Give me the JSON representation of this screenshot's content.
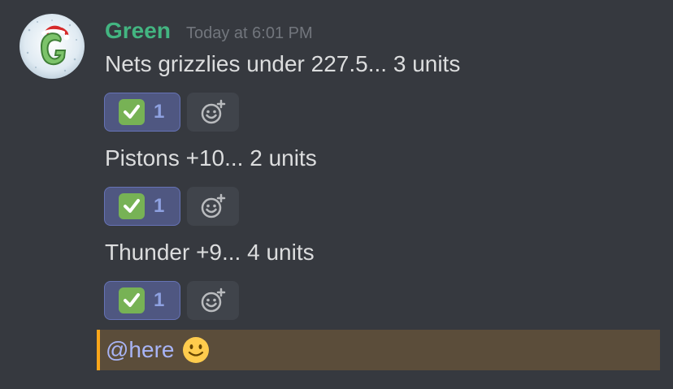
{
  "message": {
    "author": "Green",
    "timestamp": "Today at 6:01 PM",
    "avatar_icon": "g-logo-santa-hat-avatar",
    "lines": [
      {
        "text": "Nets grizzlies under 227.5... 3 units",
        "reaction_emoji": "check-mark-button-icon",
        "reaction_count": "1"
      },
      {
        "text": "Pistons +10... 2 units",
        "reaction_emoji": "check-mark-button-icon",
        "reaction_count": "1"
      },
      {
        "text": "Thunder +9... 4 units",
        "reaction_emoji": "check-mark-button-icon",
        "reaction_count": "1"
      }
    ],
    "mention_line": {
      "mention": "@here",
      "emoji": "slightly-smiling-face-icon"
    }
  },
  "colors": {
    "background": "#36393f",
    "username": "#43b581",
    "timestamp": "#72767d",
    "text": "#dcddde",
    "reaction_bg": "#4f5781",
    "reaction_count": "#8ea1e1",
    "mention_highlight_bg": "#5b4d3a",
    "mention_border": "#faa61a",
    "mention_text": "#a8b4f5"
  }
}
